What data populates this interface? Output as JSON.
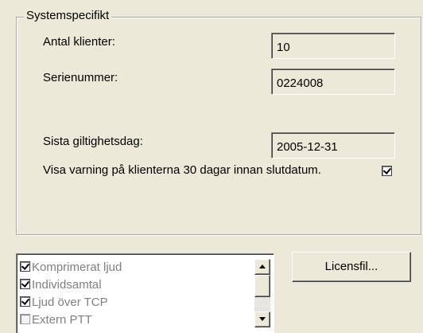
{
  "group": {
    "title": "Systemspecifikt",
    "fields": [
      {
        "label": "Antal klienter:",
        "value": "10"
      },
      {
        "label": "Serienummer:",
        "value": "0224008"
      },
      {
        "label": "Sista giltighetsdag:",
        "value": "2005-12-31"
      }
    ],
    "warning": {
      "label": "Visa varning på klienterna 30 dagar innan slutdatum.",
      "checked": true
    }
  },
  "features": {
    "items": [
      {
        "label": "Komprimerat ljud",
        "checked": true
      },
      {
        "label": "Individsamtal",
        "checked": true
      },
      {
        "label": "Ljud över TCP",
        "checked": true
      },
      {
        "label": "Extern PTT",
        "checked": false
      }
    ]
  },
  "buttons": {
    "license_file": "Licensfil..."
  }
}
